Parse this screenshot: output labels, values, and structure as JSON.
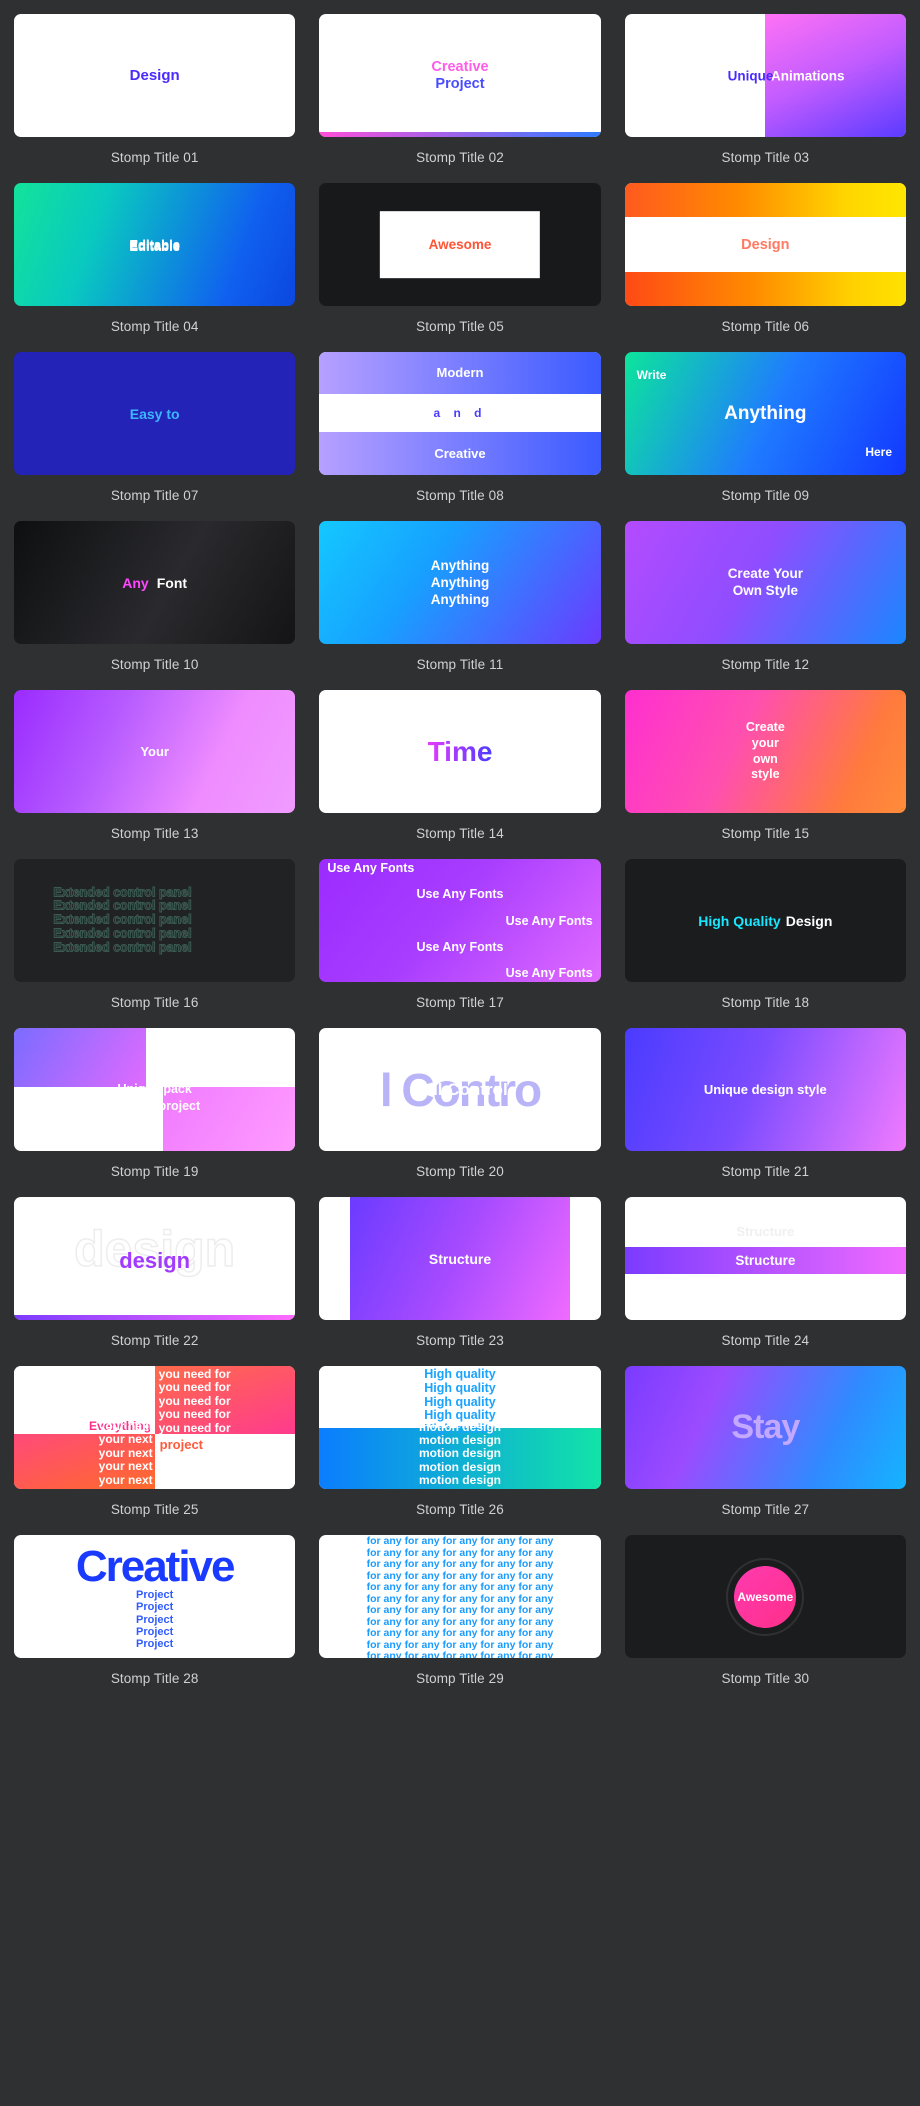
{
  "page": {
    "background": "#2e3032",
    "columns": 3,
    "card_count": 30
  },
  "cards": [
    {
      "caption": "Stomp Title 01",
      "texts": [
        "Design"
      ]
    },
    {
      "caption": "Stomp Title 02",
      "texts": [
        "Creative",
        "Project"
      ]
    },
    {
      "caption": "Stomp Title 03",
      "texts": [
        "Unique",
        "Animations"
      ]
    },
    {
      "caption": "Stomp Title 04",
      "texts": [
        "Editable",
        "Editable",
        "Editable"
      ]
    },
    {
      "caption": "Stomp Title 05",
      "texts": [
        "Awesome"
      ]
    },
    {
      "caption": "Stomp Title 06",
      "texts": [
        "Design"
      ]
    },
    {
      "caption": "Stomp Title 07",
      "texts": [
        "Easy to"
      ]
    },
    {
      "caption": "Stomp Title 08",
      "texts": [
        "Modern",
        "a n d",
        "Creative"
      ]
    },
    {
      "caption": "Stomp Title 09",
      "texts": [
        "Write",
        "Anything",
        "Here"
      ]
    },
    {
      "caption": "Stomp Title 10",
      "texts": [
        "Any",
        "Font"
      ]
    },
    {
      "caption": "Stomp Title 11",
      "texts": [
        "Anything",
        "Anything",
        "Anything"
      ]
    },
    {
      "caption": "Stomp Title 12",
      "texts": [
        "Create Your",
        "Own Style"
      ]
    },
    {
      "caption": "Stomp Title 13",
      "texts": [
        "Your"
      ]
    },
    {
      "caption": "Stomp Title 14",
      "texts": [
        "Time"
      ]
    },
    {
      "caption": "Stomp Title 15",
      "texts": [
        "Create",
        "your",
        "own",
        "style"
      ]
    },
    {
      "caption": "Stomp Title 16",
      "texts": [
        "Extended control panel",
        "Extended control panel",
        "Extended control panel",
        "Extended control panel",
        "Extended control panel"
      ]
    },
    {
      "caption": "Stomp Title 17",
      "texts": [
        "Use Any Fonts",
        "Use Any Fonts",
        "Use Any Fonts",
        "Use Any Fonts",
        "Use Any Fonts"
      ]
    },
    {
      "caption": "Stomp Title 18",
      "texts": [
        "High Quality",
        "Design"
      ]
    },
    {
      "caption": "Stomp Title 19",
      "texts": [
        "Unique pack",
        "For you project"
      ]
    },
    {
      "caption": "Stomp Title 20",
      "texts": [
        "l Contro",
        "Full Control"
      ]
    },
    {
      "caption": "Stomp Title 21",
      "texts": [
        "Unique design style"
      ]
    },
    {
      "caption": "Stomp Title 22",
      "texts": [
        "design",
        "design"
      ]
    },
    {
      "caption": "Stomp Title 23",
      "texts": [
        "Structure"
      ]
    },
    {
      "caption": "Stomp Title 24",
      "texts": [
        "Structure",
        "Structure"
      ]
    },
    {
      "caption": "Stomp Title 25",
      "texts": [
        "Everything",
        "you need for",
        "your next",
        "project"
      ]
    },
    {
      "caption": "Stomp Title 26",
      "texts": [
        "High quality",
        "motion design"
      ]
    },
    {
      "caption": "Stomp Title 27",
      "texts": [
        "Stay"
      ]
    },
    {
      "caption": "Stomp Title 28",
      "texts": [
        "Creative",
        "Project"
      ]
    },
    {
      "caption": "Stomp Title 29",
      "texts": [
        "for any"
      ]
    },
    {
      "caption": "Stomp Title 30",
      "texts": [
        "Awesome"
      ]
    }
  ],
  "card_text": {
    "c1_design": "Design",
    "c2_creative": "Creative",
    "c2_project": "Project",
    "c3_unique": "Unique",
    "c3_animations": "Animations",
    "c4_a": "Editable",
    "c4_b": "Editable",
    "c4_c": "Editable",
    "c5_awesome": "Awesome",
    "c6_design": "Design",
    "c7_easy": "Easy to",
    "c8_modern": "Modern",
    "c8_and": "a n d",
    "c8_creative": "Creative",
    "c9_write": "Write",
    "c9_anything": "Anything",
    "c9_here": "Here",
    "c10_any": "Any",
    "c10_font": "Font",
    "c11_1": "Anything",
    "c11_2": "Anything",
    "c11_3": "Anything",
    "c12_1": "Create Your",
    "c12_2": "Own Style",
    "c13_your": "Your",
    "c14_time": "Time",
    "c15_1": "Create",
    "c15_2": "your",
    "c15_3": "own",
    "c15_4": "style",
    "c16_line": "Extended control panel",
    "c17_line": "Use Any Fonts",
    "c18_a": "High Quality",
    "c18_b": "Design",
    "c19_1": "Unique pack",
    "c19_2": "For you project",
    "c20_ghost": "l Contro",
    "c20_fg": "Full Control",
    "c21_text": "Unique design style",
    "c22_ghost": "design",
    "c22_fg": "design",
    "c23_structure": "Structure",
    "c24_structure": "Structure",
    "c24_ghost": "Structure",
    "c25_everything": "Everything",
    "c25_need": "you need for",
    "c25_next": "your next",
    "c25_project": "project",
    "c26_hq": "High quality",
    "c26_md": "motion design",
    "c27_stay": "Stay",
    "c28_big": "Creative",
    "c28_line": "Project",
    "c29_line": "for any",
    "c30_awesome": "Awesome"
  },
  "colors": {
    "page_bg": "#2e3032",
    "caption": "#cfd2d4",
    "accent_blue": "#4a2bff",
    "accent_pink": "#ff5ce8",
    "accent_cyan": "#19e6ff",
    "accent_orange": "#ff5436",
    "accent_green": "#12e39a",
    "accent_purple": "#9a2bff"
  }
}
